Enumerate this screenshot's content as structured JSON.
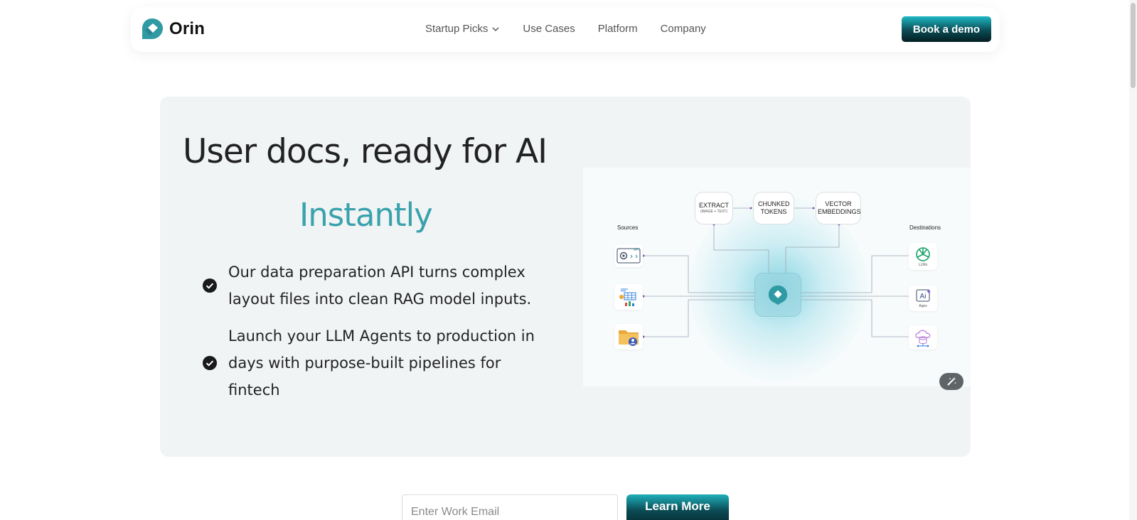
{
  "brand": {
    "name": "Orin",
    "accent": "#3aa2ac"
  },
  "nav": {
    "items": [
      {
        "label": "Startup Picks",
        "has_dropdown": true
      },
      {
        "label": "Use Cases"
      },
      {
        "label": "Platform"
      },
      {
        "label": "Company"
      }
    ],
    "cta_label": "Book a demo"
  },
  "hero": {
    "title": "User docs, ready for AI",
    "accent": "Instantly",
    "bullets": [
      "Our data preparation API turns complex layout files into clean RAG model inputs.",
      "Launch your LLM Agents to production in days with purpose-built pipelines for fintech"
    ]
  },
  "diagram": {
    "steps": [
      {
        "label": "EXTRACT",
        "sub": "(IMAGE + TEXT)"
      },
      {
        "label": "CHUNKED TOKENS",
        "sub": ""
      },
      {
        "label": "VECTOR EMBEDDINGS",
        "sub": ""
      }
    ],
    "sources_label": "Sources",
    "destinations_label": "Destinations",
    "source_icons": [
      {
        "icon": "api-gear-icon",
        "caption": "API"
      },
      {
        "icon": "spreadsheet-chart-icon",
        "caption": ""
      },
      {
        "icon": "folder-user-icon",
        "caption": ""
      }
    ],
    "destination_icons": [
      {
        "icon": "openai-icon",
        "caption": "LLMs"
      },
      {
        "icon": "ai-apps-icon",
        "caption": "Apps"
      },
      {
        "icon": "cloud-database-icon",
        "caption": ""
      }
    ]
  },
  "form": {
    "email_placeholder": "Enter Work Email",
    "submit_label": "Learn More"
  }
}
